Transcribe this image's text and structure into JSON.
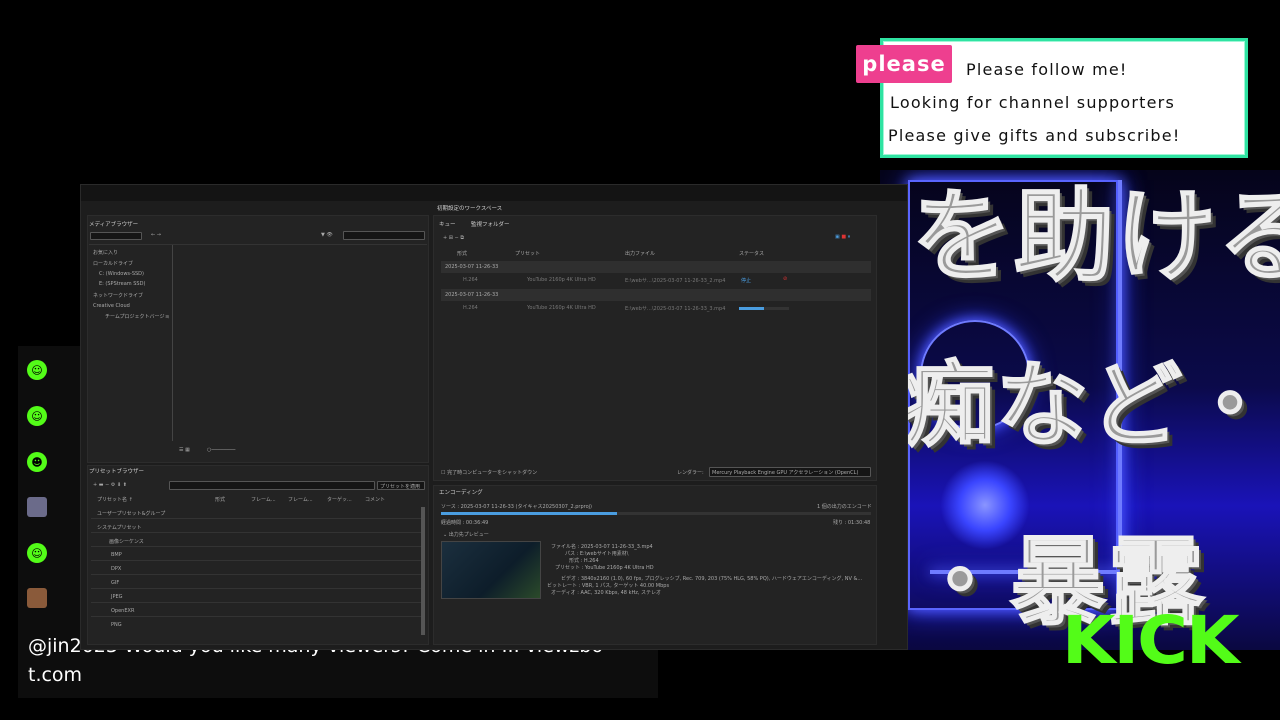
{
  "overlay": {
    "please_tag": "please",
    "lines": [
      "Please follow me!",
      "Looking for channel supporters",
      "Please give gifts and subscribe!"
    ],
    "jp_line1": "を助ける",
    "jp_line2": "痴など・・・",
    "jp_line3": "・暴露",
    "kick_logo": "KICK",
    "colors": {
      "panel_border": "#2fe3a2",
      "please_tag": "#ee3f8f",
      "kick": "#53fc18",
      "neon": "#3a45ff"
    }
  },
  "chat": {
    "message": "@jin2023 Would you like many viewers? Come in ... viewzbot.com",
    "message_display_line1": "@jin2023 Would you like many viewers? Come in ... viewzbo",
    "message_display_line2": "t.com",
    "icons": [
      "kick-user-icon",
      "kick-user-icon",
      "kick-user-icon",
      "avatar",
      "kick-user-icon",
      "avatar"
    ]
  },
  "app": {
    "workspace_title": "初期設定のワークスペース",
    "media_browser": {
      "title": "メディアブラウザー",
      "tree": [
        "お気に入り",
        "ローカルドライブ",
        "C: (Windows-SSD)",
        "E: (SPStream SSD)",
        "ネットワークドライブ",
        "Creative Cloud",
        "チームプロジェクトバージョ"
      ]
    },
    "queue": {
      "tabs": [
        "キュー",
        "監視フォルダー"
      ],
      "columns": [
        "形式",
        "プリセット",
        "出力ファイル",
        "ステータス"
      ],
      "groups": [
        {
          "name": "2025-03-07 11-26-33",
          "format": "H.264",
          "preset": "YouTube 2160p 4K Ultra HD",
          "output": "E:\\webサ…\\2025-03-07 11-26-33_2.mp4",
          "status": "停止",
          "progress": 0.3
        },
        {
          "name": "2025-03-07 11-26-33",
          "format": "H.264",
          "preset": "YouTube 2160p 4K Ultra HD",
          "output": "E:\\webサ…\\2025-03-07 11-26-33_3.mp4",
          "status": "",
          "progress": 0.5
        }
      ],
      "shutdown_label": "完了時コンピューターをシャットダウン",
      "renderer_label": "レンダラー:",
      "renderer_value": "Mercury Playback Engine GPU アクセラレーション (OpenCL)"
    },
    "preset_browser": {
      "title": "プリセットブラウザー",
      "apply_button": "プリセットを適用",
      "columns": [
        "プリセット名 ↑",
        "形式",
        "フレーム...",
        "フレーム...",
        "ターゲッ...",
        "コメント"
      ],
      "rows": [
        "ユーザープリセット&グループ",
        "システムプリセット",
        "画像シーケンス",
        "BMP",
        "DPX",
        "GIF",
        "JPEG",
        "OpenEXR",
        "PNG"
      ]
    },
    "encoding": {
      "title": "エンコーディング",
      "source": "ソース : 2025-03-07 11-26-33 (タイキャス20250307_2.prproj)",
      "count": "1 個の出力のエンコード",
      "elapsed": "経過時間 : 00:36:49",
      "remaining": "残り : 01:30:48",
      "progress": 0.41,
      "preview_label": "出力先プレビュー",
      "details": [
        "ファイル名 : 2025-03-07 11-26-33_3.mp4",
        "パス : E:\\webサイト用素材\\",
        "形式 : H.264",
        "プリセット : YouTube 2160p 4K Ultra HD",
        "ビデオ : 3840x2160 (1.0), 60 fps, プログレッシブ, Rec. 709, 203 (75% HLG, 58% PQ), ハードウェアエンコーディング, NV &...",
        "ビットレート : VBR, 1 パス, ターゲット 40.00 Mbps",
        "オーディオ : AAC, 320 Kbps, 48 kHz, ステレオ"
      ]
    }
  }
}
